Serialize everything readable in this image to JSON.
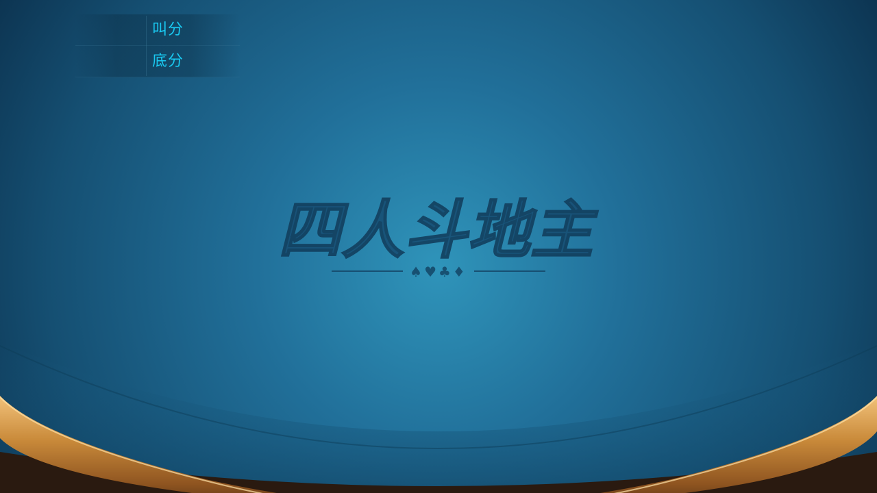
{
  "game": {
    "logo_text": "四人斗地主",
    "suit_ornament": "♠♥♣♦"
  },
  "score_panel": {
    "call_score_label": "叫分",
    "call_score_value": "",
    "base_score_label": "底分",
    "base_score_value": ""
  },
  "colors": {
    "felt_center": "#2e8fb5",
    "felt_edge": "#0f3f5f",
    "wood_rail": "#c98a3a",
    "label_cyan": "#19c8f0"
  }
}
